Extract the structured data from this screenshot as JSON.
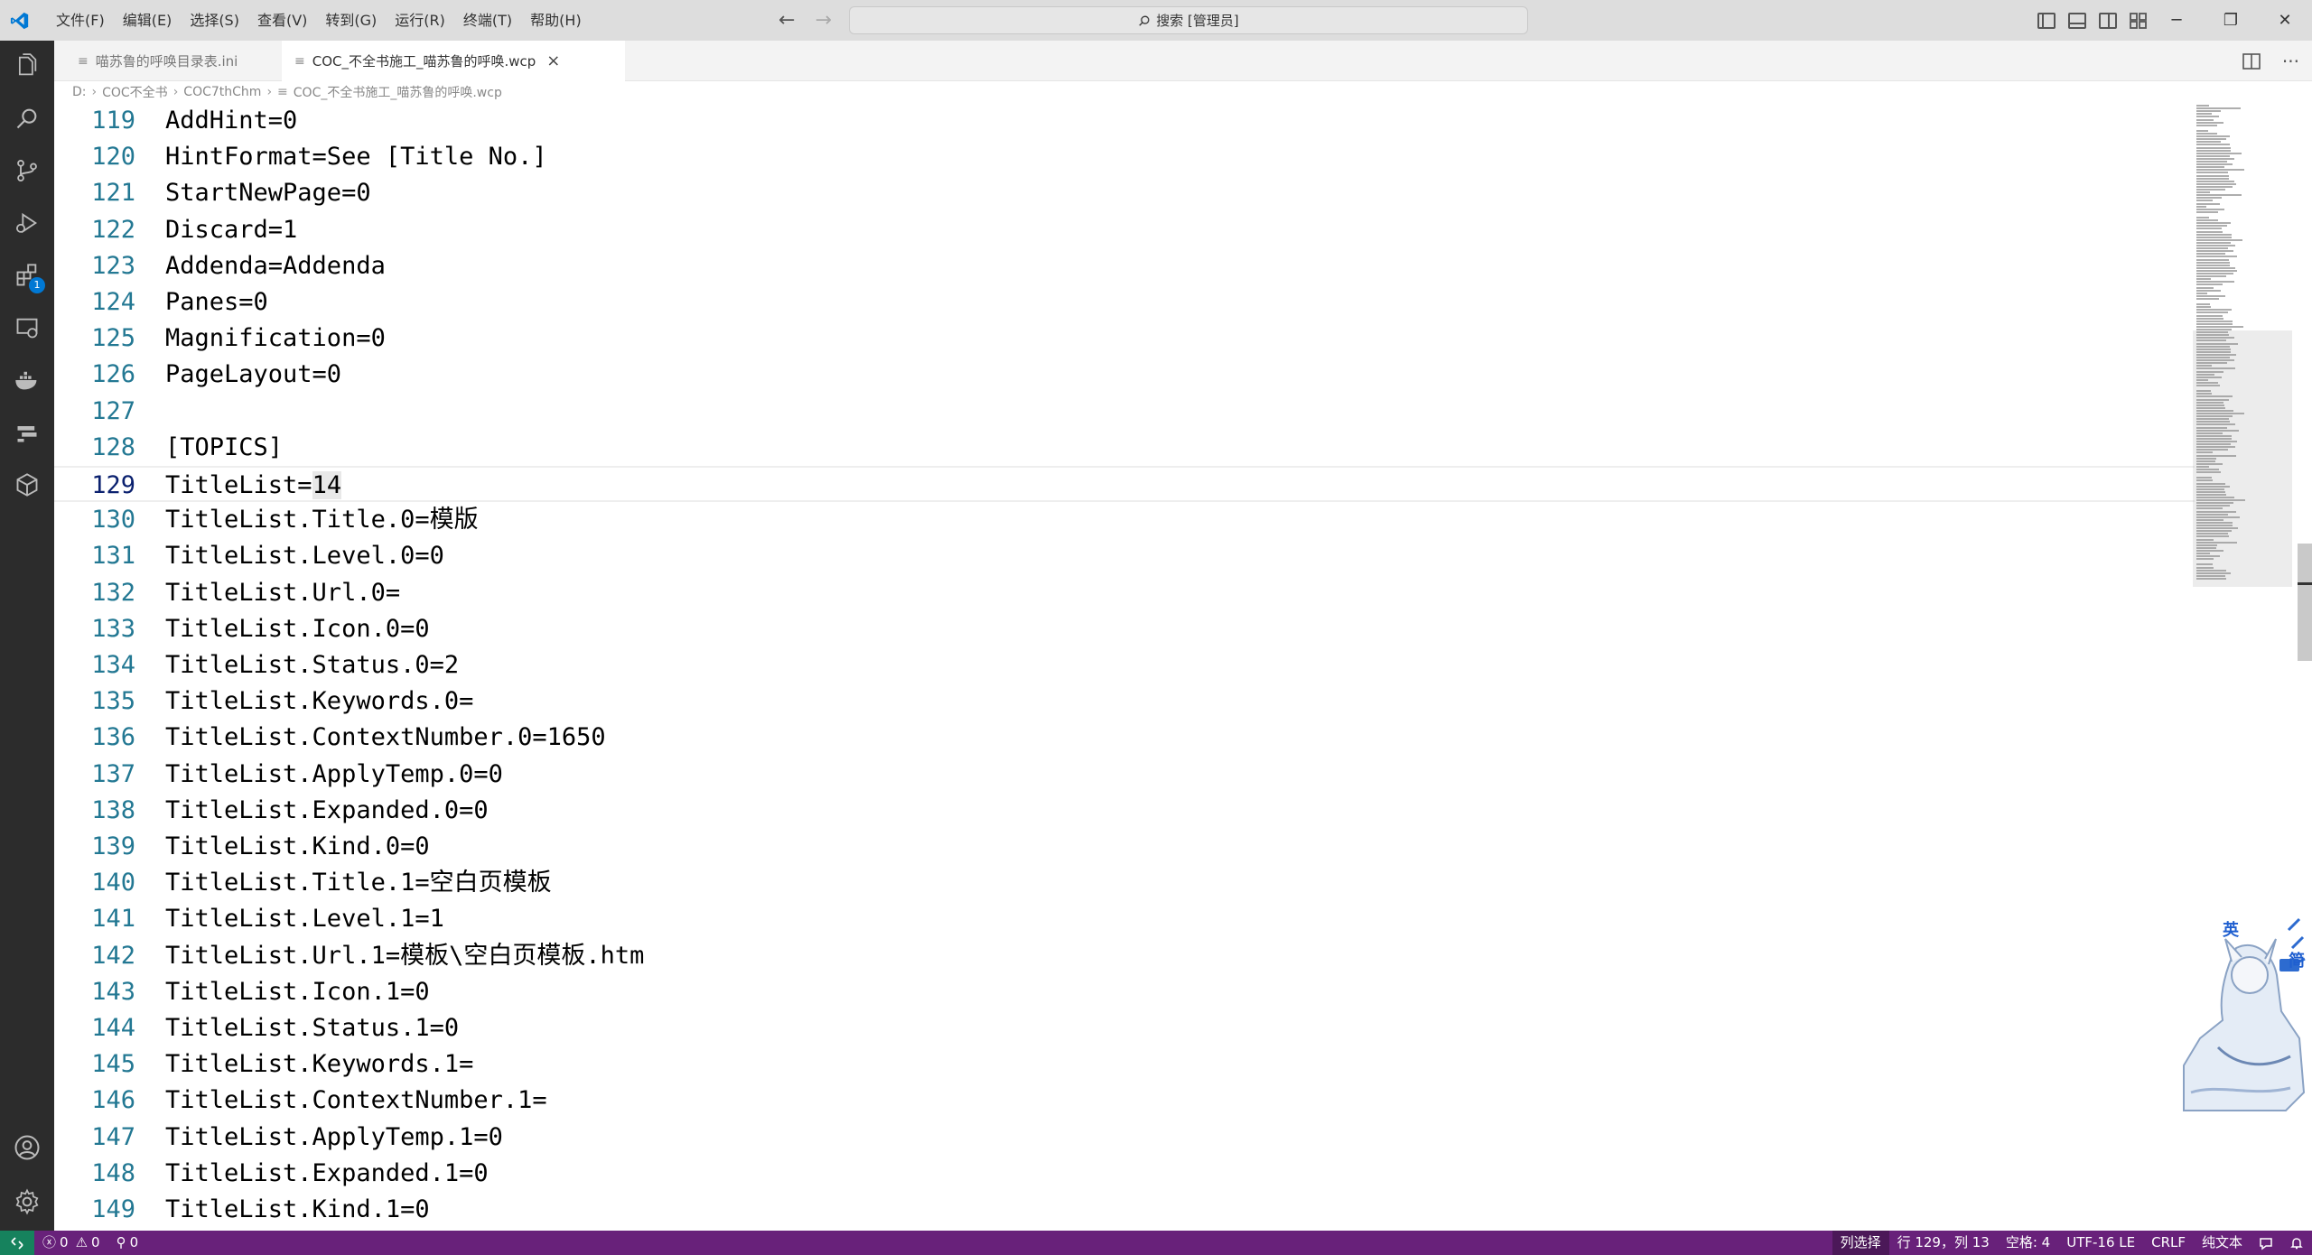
{
  "titlebar": {
    "menu": [
      "文件(F)",
      "编辑(E)",
      "选择(S)",
      "查看(V)",
      "转到(G)",
      "运行(R)",
      "终端(T)",
      "帮助(H)"
    ],
    "search_label": "搜索 [管理员]"
  },
  "activitybar": {
    "icons": [
      "explorer-icon",
      "search-icon",
      "source-control-icon",
      "run-debug-icon",
      "extensions-icon",
      "remote-explorer-icon",
      "docker-icon",
      "layers-icon",
      "package-icon",
      "account-icon",
      "settings-gear-icon"
    ],
    "extensions_badge": "1"
  },
  "tabs": [
    {
      "label": "喵苏鲁的呼唤目录表.ini",
      "active": false
    },
    {
      "label": "COC_不全书施工_喵苏鲁的呼唤.wcp",
      "active": true
    }
  ],
  "breadcrumb": [
    "D:",
    "COC不全书",
    "COC7thChm",
    "COC_不全书施工_喵苏鲁的呼唤.wcp"
  ],
  "editor": {
    "lines": [
      {
        "no": "119",
        "text": "AddHint=0"
      },
      {
        "no": "120",
        "text": "HintFormat=See [Title No.]"
      },
      {
        "no": "121",
        "text": "StartNewPage=0"
      },
      {
        "no": "122",
        "text": "Discard=1"
      },
      {
        "no": "123",
        "text": "Addenda=Addenda"
      },
      {
        "no": "124",
        "text": "Panes=0"
      },
      {
        "no": "125",
        "text": "Magnification=0"
      },
      {
        "no": "126",
        "text": "PageLayout=0"
      },
      {
        "no": "127",
        "text": ""
      },
      {
        "no": "128",
        "text": "[TOPICS]"
      },
      {
        "no": "129",
        "text": "TitleList=",
        "highlight": "14",
        "current": true
      },
      {
        "no": "130",
        "text": "TitleList.Title.0=模版"
      },
      {
        "no": "131",
        "text": "TitleList.Level.0=0"
      },
      {
        "no": "132",
        "text": "TitleList.Url.0="
      },
      {
        "no": "133",
        "text": "TitleList.Icon.0=0"
      },
      {
        "no": "134",
        "text": "TitleList.Status.0=2"
      },
      {
        "no": "135",
        "text": "TitleList.Keywords.0="
      },
      {
        "no": "136",
        "text": "TitleList.ContextNumber.0=1650"
      },
      {
        "no": "137",
        "text": "TitleList.ApplyTemp.0=0"
      },
      {
        "no": "138",
        "text": "TitleList.Expanded.0=0"
      },
      {
        "no": "139",
        "text": "TitleList.Kind.0=0"
      },
      {
        "no": "140",
        "text": "TitleList.Title.1=空白页模板"
      },
      {
        "no": "141",
        "text": "TitleList.Level.1=1"
      },
      {
        "no": "142",
        "text": "TitleList.Url.1=模板\\空白页模板.htm"
      },
      {
        "no": "143",
        "text": "TitleList.Icon.1=0"
      },
      {
        "no": "144",
        "text": "TitleList.Status.1=0"
      },
      {
        "no": "145",
        "text": "TitleList.Keywords.1="
      },
      {
        "no": "146",
        "text": "TitleList.ContextNumber.1="
      },
      {
        "no": "147",
        "text": "TitleList.ApplyTemp.1=0"
      },
      {
        "no": "148",
        "text": "TitleList.Expanded.1=0"
      },
      {
        "no": "149",
        "text": "TitleList.Kind.1=0"
      }
    ]
  },
  "ime": {
    "lang": "英",
    "mode": "简"
  },
  "statusbar": {
    "errors": "0",
    "warnings": "0",
    "ports": "0",
    "selection_mode": "列选择",
    "position": "行 129，列 13",
    "spaces": "空格: 4",
    "encoding": "UTF-16 LE",
    "eol": "CRLF",
    "language": "纯文本"
  },
  "colors": {
    "statusbar_bg": "#68217a",
    "remote_bg": "#16825d",
    "line_number": "#237893",
    "activitybar_bg": "#2c2c2c",
    "accent": "#0078d4"
  }
}
